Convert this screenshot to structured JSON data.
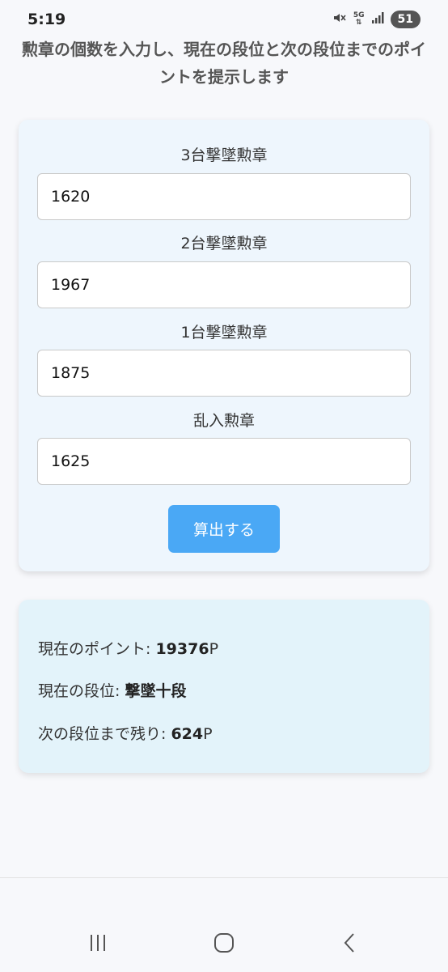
{
  "status": {
    "time": "5:19",
    "network": "5G",
    "battery": "51"
  },
  "page": {
    "title": "勲章の個数を入力し、現在の段位と次の段位までのポイントを提示します"
  },
  "form": {
    "fields": [
      {
        "label": "3台撃墜勲章",
        "value": "1620"
      },
      {
        "label": "2台撃墜勲章",
        "value": "1967"
      },
      {
        "label": "1台撃墜勲章",
        "value": "1875"
      },
      {
        "label": "乱入勲章",
        "value": "1625"
      }
    ],
    "submit_label": "算出する"
  },
  "result": {
    "points_label": "現在のポイント: ",
    "points_value": "19376",
    "points_unit": "P",
    "rank_label": "現在の段位: ",
    "rank_value": "撃墜十段",
    "next_label": "次の段位まで残り: ",
    "next_value": "624",
    "next_unit": "P"
  },
  "colors": {
    "accent": "#4aa8f5",
    "form_card_bg": "#eef6fd",
    "result_card_bg": "#e3f3fa"
  },
  "icons": {
    "mute": "mute-icon",
    "signal": "signal-icon",
    "recents": "recents-icon",
    "home": "home-icon",
    "back": "back-icon"
  }
}
